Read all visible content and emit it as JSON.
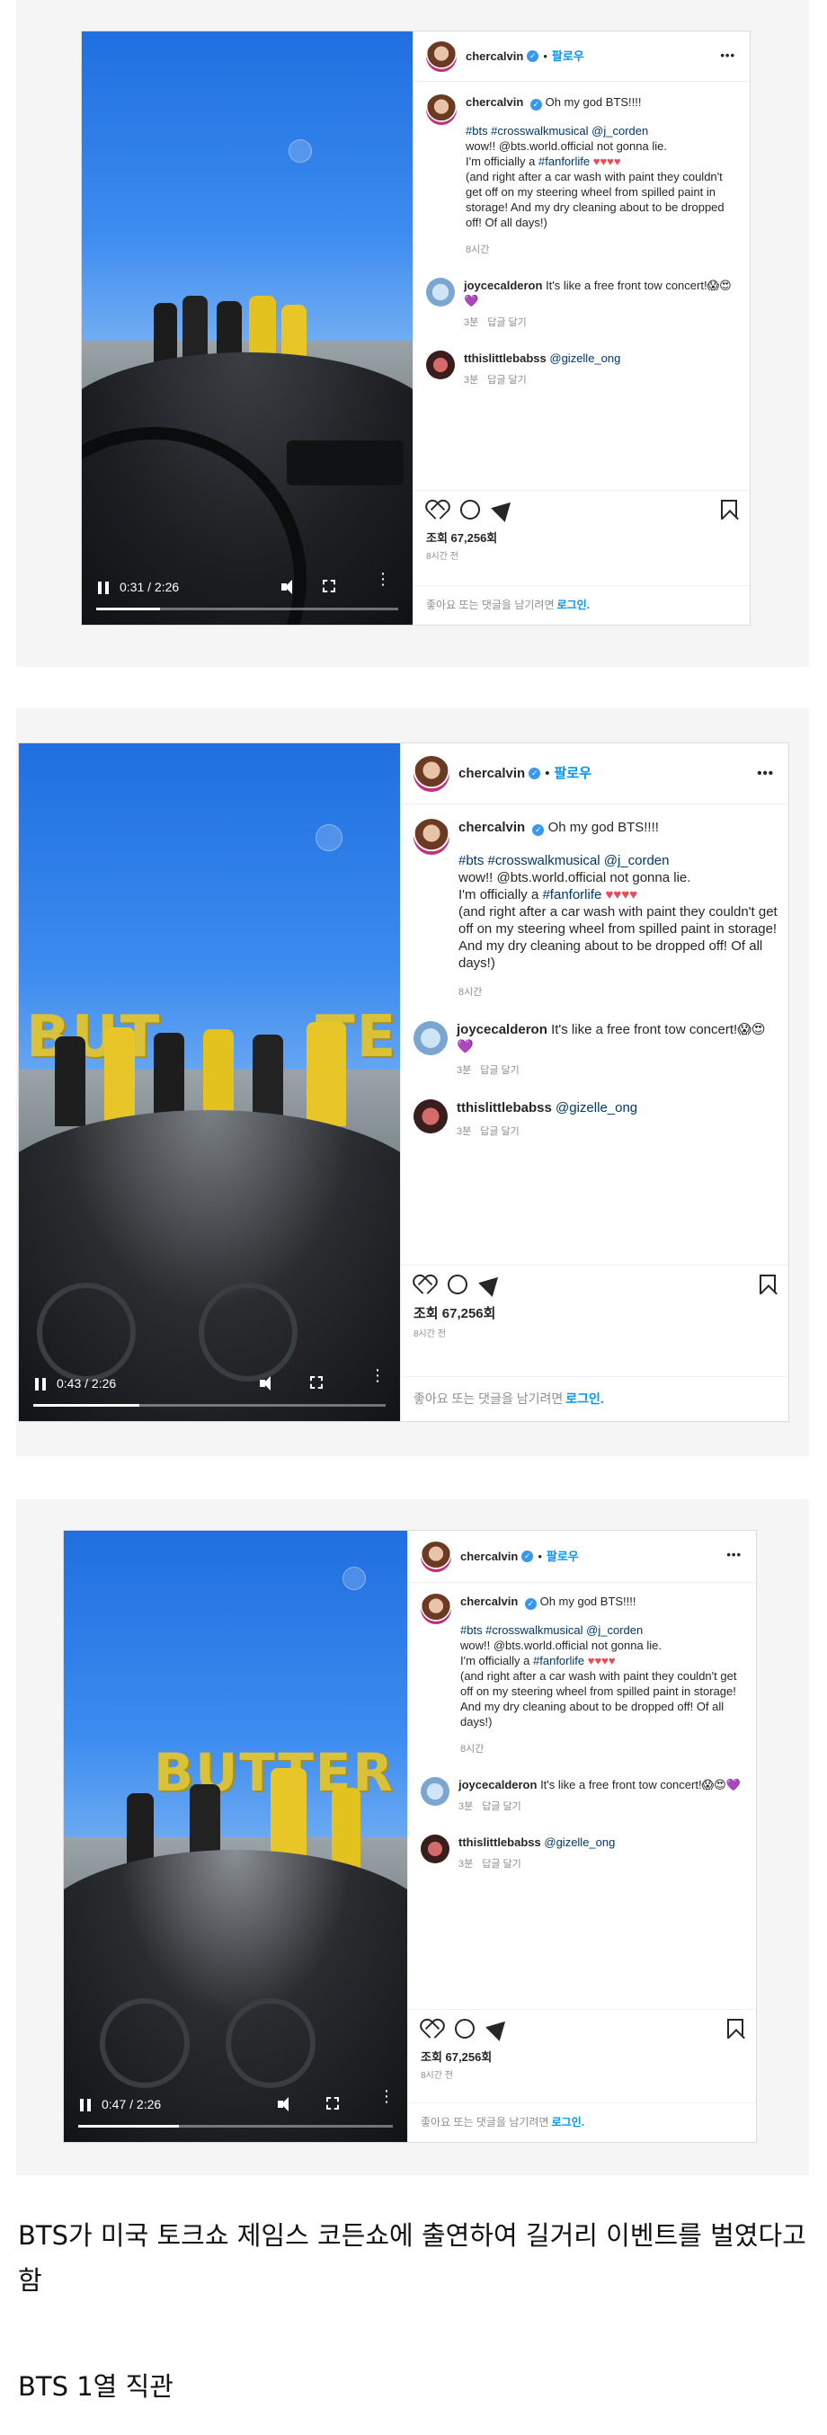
{
  "post": {
    "username": "chercalvin",
    "follow_label": "팔로우",
    "caption_opening": "Oh my god BTS!!!!",
    "caption_hashtags": "#bts #crosswalkmusical @j_corden",
    "caption_line2": "wow!! @bts.world.official not gonna lie.",
    "caption_line3_text": "I'm officially a",
    "caption_line3_tag": "#fanforlife",
    "caption_hearts": "♥♥♥♥",
    "caption_rest": "(and right after a car wash with paint they couldn't get off on my steering wheel from spilled paint in storage! And my dry cleaning about to be dropped off! Of all days!)",
    "caption_age": "8시간",
    "comments": [
      {
        "username": "joycecalderon",
        "text": "It's like a free front tow concert!😱😍💜",
        "age": "3분",
        "reply_label": "답글 달기"
      },
      {
        "username": "tthislittlebabss",
        "text": "@gizelle_ong",
        "age": "3분",
        "reply_label": "답글 달기"
      }
    ],
    "views_label": "조회 67,256회",
    "posted_label": "8시간 전",
    "add_comment_prompt": "좋아요 또는 댓글을 남기려면",
    "login_label": "로그인."
  },
  "videos": [
    {
      "time": "0:31 / 2:26",
      "progress": 0.21
    },
    {
      "time": "0:43 / 2:26",
      "progress": 0.3
    },
    {
      "time": "0:47 / 2:26",
      "progress": 0.32
    }
  ],
  "description": {
    "line1": "BTS가 미국 토크쇼 제임스 코든쇼에 출연하여 길거리 이벤트를 벌였다고함",
    "line2": "BTS 1열 직관"
  },
  "colors": {
    "link": "#0095f6",
    "verified": "#3897f0",
    "hashtag": "#00376b",
    "heart": "#ed4956"
  },
  "icons": [
    "heart-icon",
    "comment-icon",
    "share-icon",
    "bookmark-icon",
    "more-icon",
    "verified-icon",
    "pause-icon",
    "volume-icon",
    "fullscreen-icon"
  ]
}
